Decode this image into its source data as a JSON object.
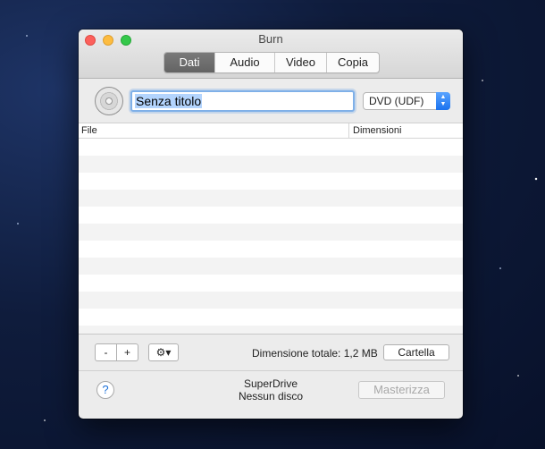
{
  "window": {
    "title": "Burn",
    "tabs": [
      {
        "label": "Dati",
        "active": true
      },
      {
        "label": "Audio",
        "active": false
      },
      {
        "label": "Video",
        "active": false
      },
      {
        "label": "Copia",
        "active": false
      }
    ]
  },
  "disc": {
    "icon": "cd-disc-icon",
    "name_value": "Senza titolo",
    "filesystem_selected": "DVD (UDF)"
  },
  "table": {
    "columns": [
      "File",
      "Dimensioni"
    ],
    "rows": []
  },
  "toolbar": {
    "remove_label": "-",
    "add_label": "+",
    "actions_icon": "gear-icon",
    "actions_label": "⚙▾",
    "total_size_label": "Dimensione totale: 1,2 MB",
    "folder_button": "Cartella"
  },
  "footer": {
    "help_label": "?",
    "drive_name": "SuperDrive",
    "drive_status": "Nessun disco",
    "burn_button": "Masterizza"
  },
  "colors": {
    "tab_active_bg": "#6e6e6e",
    "select_accent": "#1a72ef",
    "focus_ring": "#7fb0e8"
  }
}
